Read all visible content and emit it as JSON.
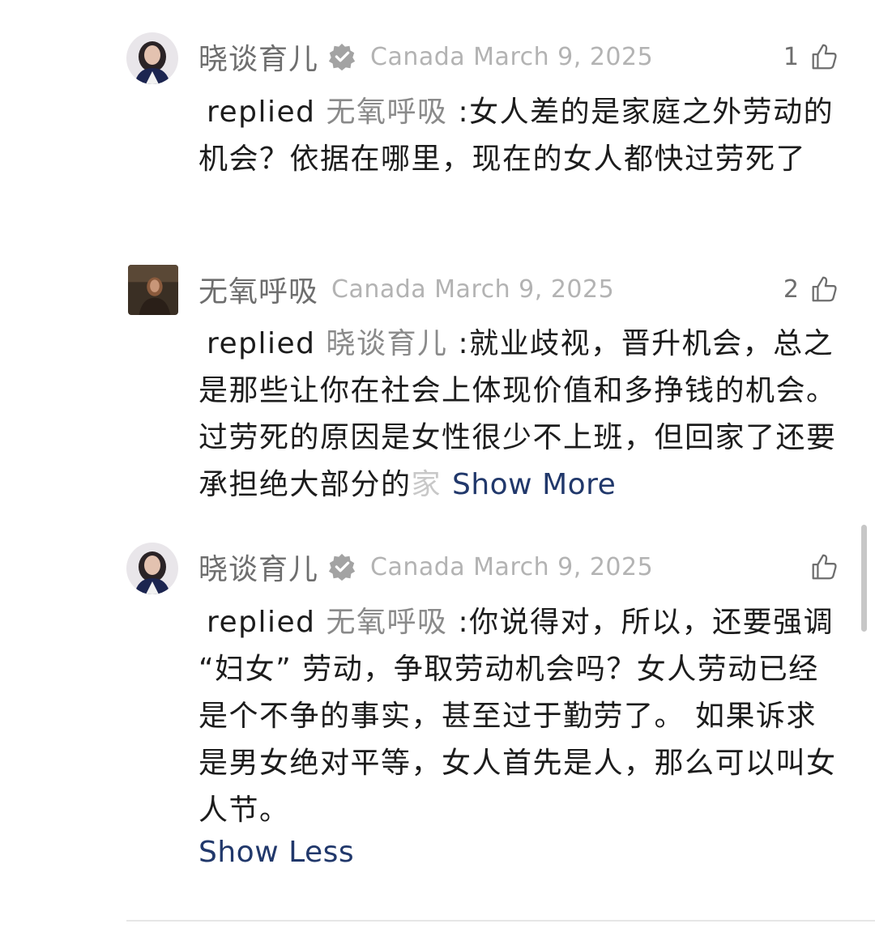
{
  "comments": [
    {
      "username": "晓谈育儿",
      "verified": true,
      "location": "Canada",
      "date": "March 9, 2025",
      "likes": "1",
      "replied_label": "replied",
      "reply_target": "无氧呼吸",
      "text": ":女人差的是家庭之外劳动的机会？依据在哪里，现在的女人都快过劳死了"
    },
    {
      "username": "无氧呼吸",
      "verified": false,
      "location": "Canada",
      "date": "March 9, 2025",
      "likes": "2",
      "replied_label": "replied",
      "reply_target": "晓谈育儿",
      "text": ":就业歧视，晋升机会，总之是那些让你在社会上体现价值和多挣钱的机会。过劳死的原因是女性很少不上班，但回家了还要承担绝大部分的",
      "text_faded": "家",
      "show_more": "Show More"
    },
    {
      "username": "晓谈育儿",
      "verified": true,
      "location": "Canada",
      "date": "March 9, 2025",
      "likes": "",
      "replied_label": "replied",
      "reply_target": "无氧呼吸",
      "text": ":你说得对，所以，还要强调 “妇女” 劳动，争取劳动机会吗？女人劳动已经是个不争的事实，甚至过于勤劳了。 如果诉求是男女绝对平等，女人首先是人，那么可以叫女人节。",
      "show_less": "Show Less"
    }
  ],
  "colors": {
    "username": "#6e6e6e",
    "meta": "#b3b3b3",
    "link": "#21386b",
    "reply_target": "#8a8a8a"
  },
  "icons": {
    "verified": "verified-badge-icon",
    "like": "thumbs-up-icon"
  }
}
